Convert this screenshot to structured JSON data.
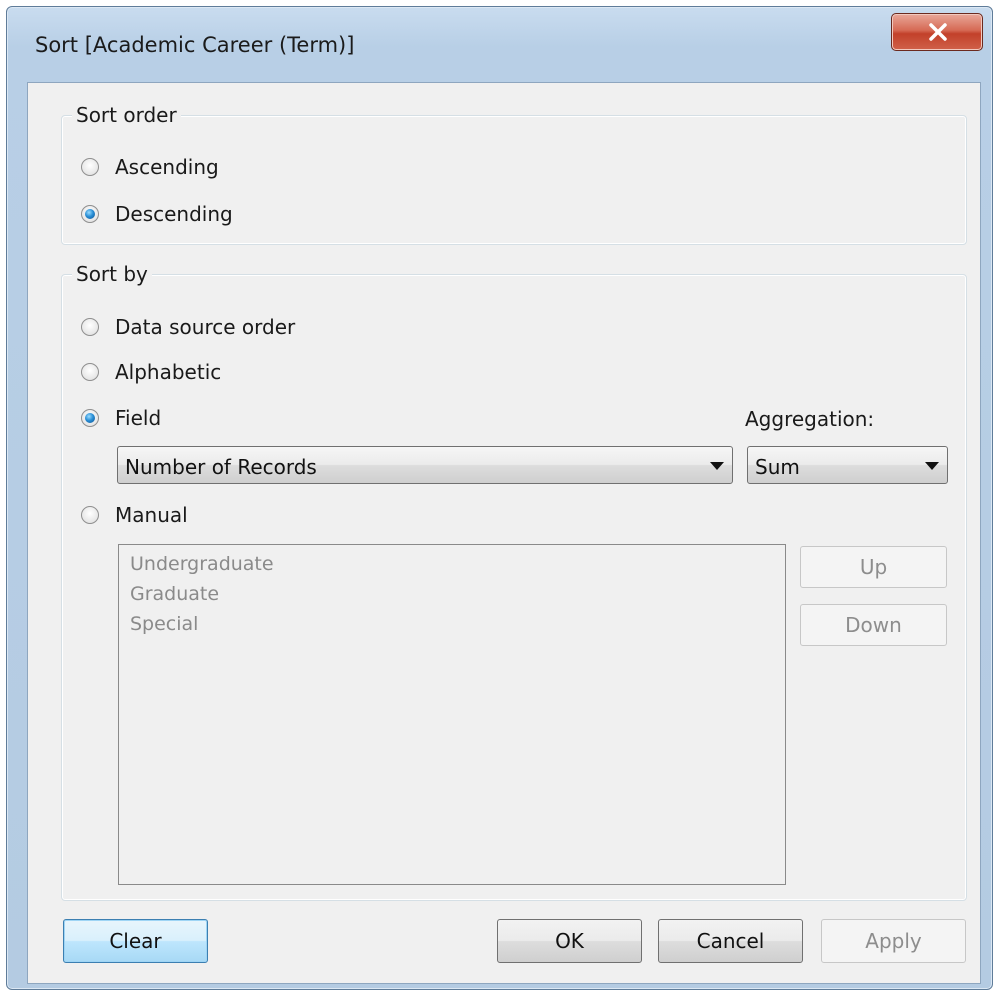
{
  "dialog": {
    "title": "Sort [Academic Career (Term)]"
  },
  "sort_order": {
    "label": "Sort order",
    "options": [
      "Ascending",
      "Descending"
    ],
    "selected": "Descending"
  },
  "sort_by": {
    "label": "Sort by",
    "options": {
      "data_source": "Data source order",
      "alphabetic": "Alphabetic",
      "field": "Field",
      "manual": "Manual"
    },
    "selected": "Field",
    "field_select": {
      "value": "Number of Records"
    },
    "aggregation": {
      "label": "Aggregation:",
      "value": "Sum"
    },
    "manual_items": [
      "Undergraduate",
      "Graduate",
      "Special"
    ],
    "up_label": "Up",
    "down_label": "Down"
  },
  "buttons": {
    "clear": "Clear",
    "ok": "OK",
    "cancel": "Cancel",
    "apply": "Apply"
  },
  "colors": {
    "radio_selected": "#2a8fd6",
    "close_button": "#c2412a",
    "default_button_border": "#3c7fb1"
  },
  "icons": {
    "close": "close-icon"
  }
}
